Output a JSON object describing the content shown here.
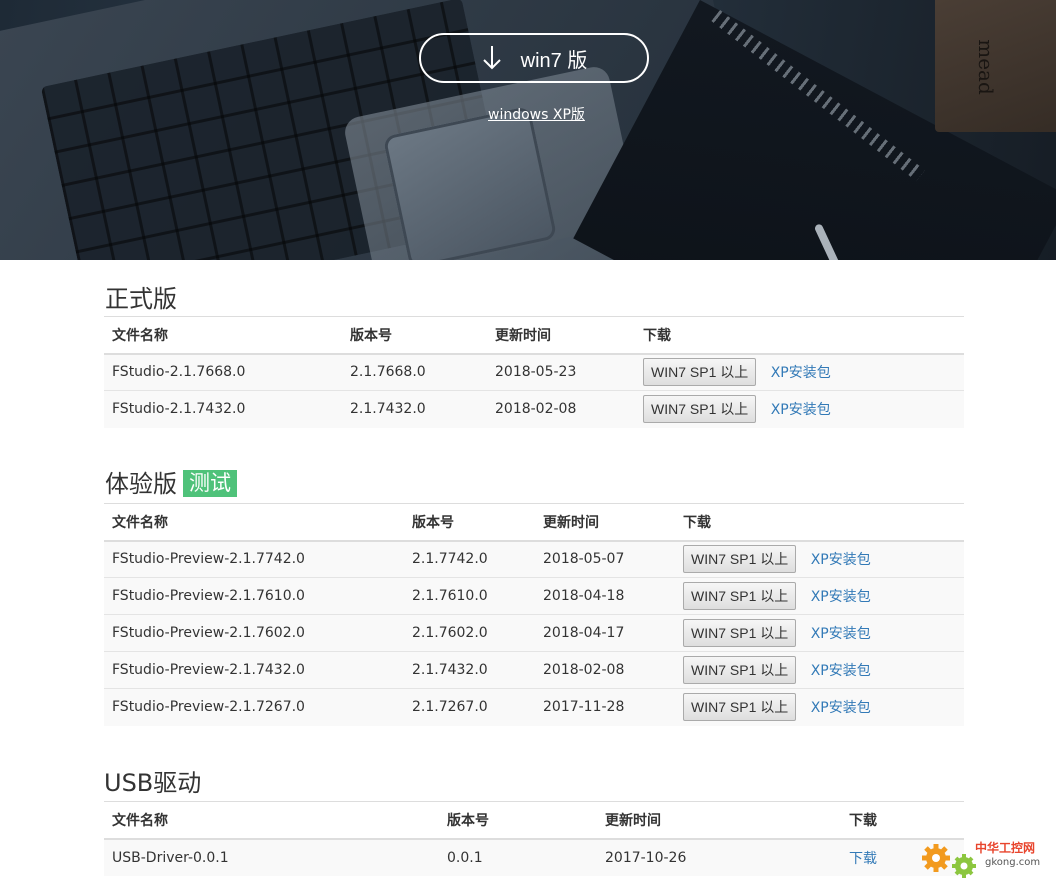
{
  "hero": {
    "win7_label": "win7 版",
    "xp_link": "windows XP版",
    "notebook_brand": "mead"
  },
  "release": {
    "title": "正式版",
    "headers": [
      "文件名称",
      "版本号",
      "更新时间",
      "下载"
    ],
    "rows": [
      {
        "name": "FStudio-2.1.7668.0",
        "version": "2.1.7668.0",
        "date": "2018-05-23",
        "btn": "WIN7 SP1 以上",
        "xp": "XP安装包"
      },
      {
        "name": "FStudio-2.1.7432.0",
        "version": "2.1.7432.0",
        "date": "2018-02-08",
        "btn": "WIN7 SP1 以上",
        "xp": "XP安装包"
      }
    ]
  },
  "preview": {
    "title": "体验版",
    "badge": "测试",
    "headers": [
      "文件名称",
      "版本号",
      "更新时间",
      "下载"
    ],
    "rows": [
      {
        "name": "FStudio-Preview-2.1.7742.0",
        "version": "2.1.7742.0",
        "date": "2018-05-07",
        "btn": "WIN7 SP1 以上",
        "xp": "XP安装包"
      },
      {
        "name": "FStudio-Preview-2.1.7610.0",
        "version": "2.1.7610.0",
        "date": "2018-04-18",
        "btn": "WIN7 SP1 以上",
        "xp": "XP安装包"
      },
      {
        "name": "FStudio-Preview-2.1.7602.0",
        "version": "2.1.7602.0",
        "date": "2018-04-17",
        "btn": "WIN7 SP1 以上",
        "xp": "XP安装包"
      },
      {
        "name": "FStudio-Preview-2.1.7432.0",
        "version": "2.1.7432.0",
        "date": "2018-02-08",
        "btn": "WIN7 SP1 以上",
        "xp": "XP安装包"
      },
      {
        "name": "FStudio-Preview-2.1.7267.0",
        "version": "2.1.7267.0",
        "date": "2017-11-28",
        "btn": "WIN7 SP1 以上",
        "xp": "XP安装包"
      }
    ]
  },
  "usb": {
    "title": "USB驱动",
    "headers": [
      "文件名称",
      "版本号",
      "更新时间",
      "下载"
    ],
    "rows": [
      {
        "name": "USB-Driver-0.0.1",
        "version": "0.0.1",
        "date": "2017-10-26",
        "link": "下载"
      }
    ]
  },
  "watermark": {
    "text": "中华工控网",
    "domain": "gkong.com"
  },
  "colors": {
    "link": "#337ab7",
    "badge": "#4fc27a",
    "watermark": "#e8452d"
  }
}
